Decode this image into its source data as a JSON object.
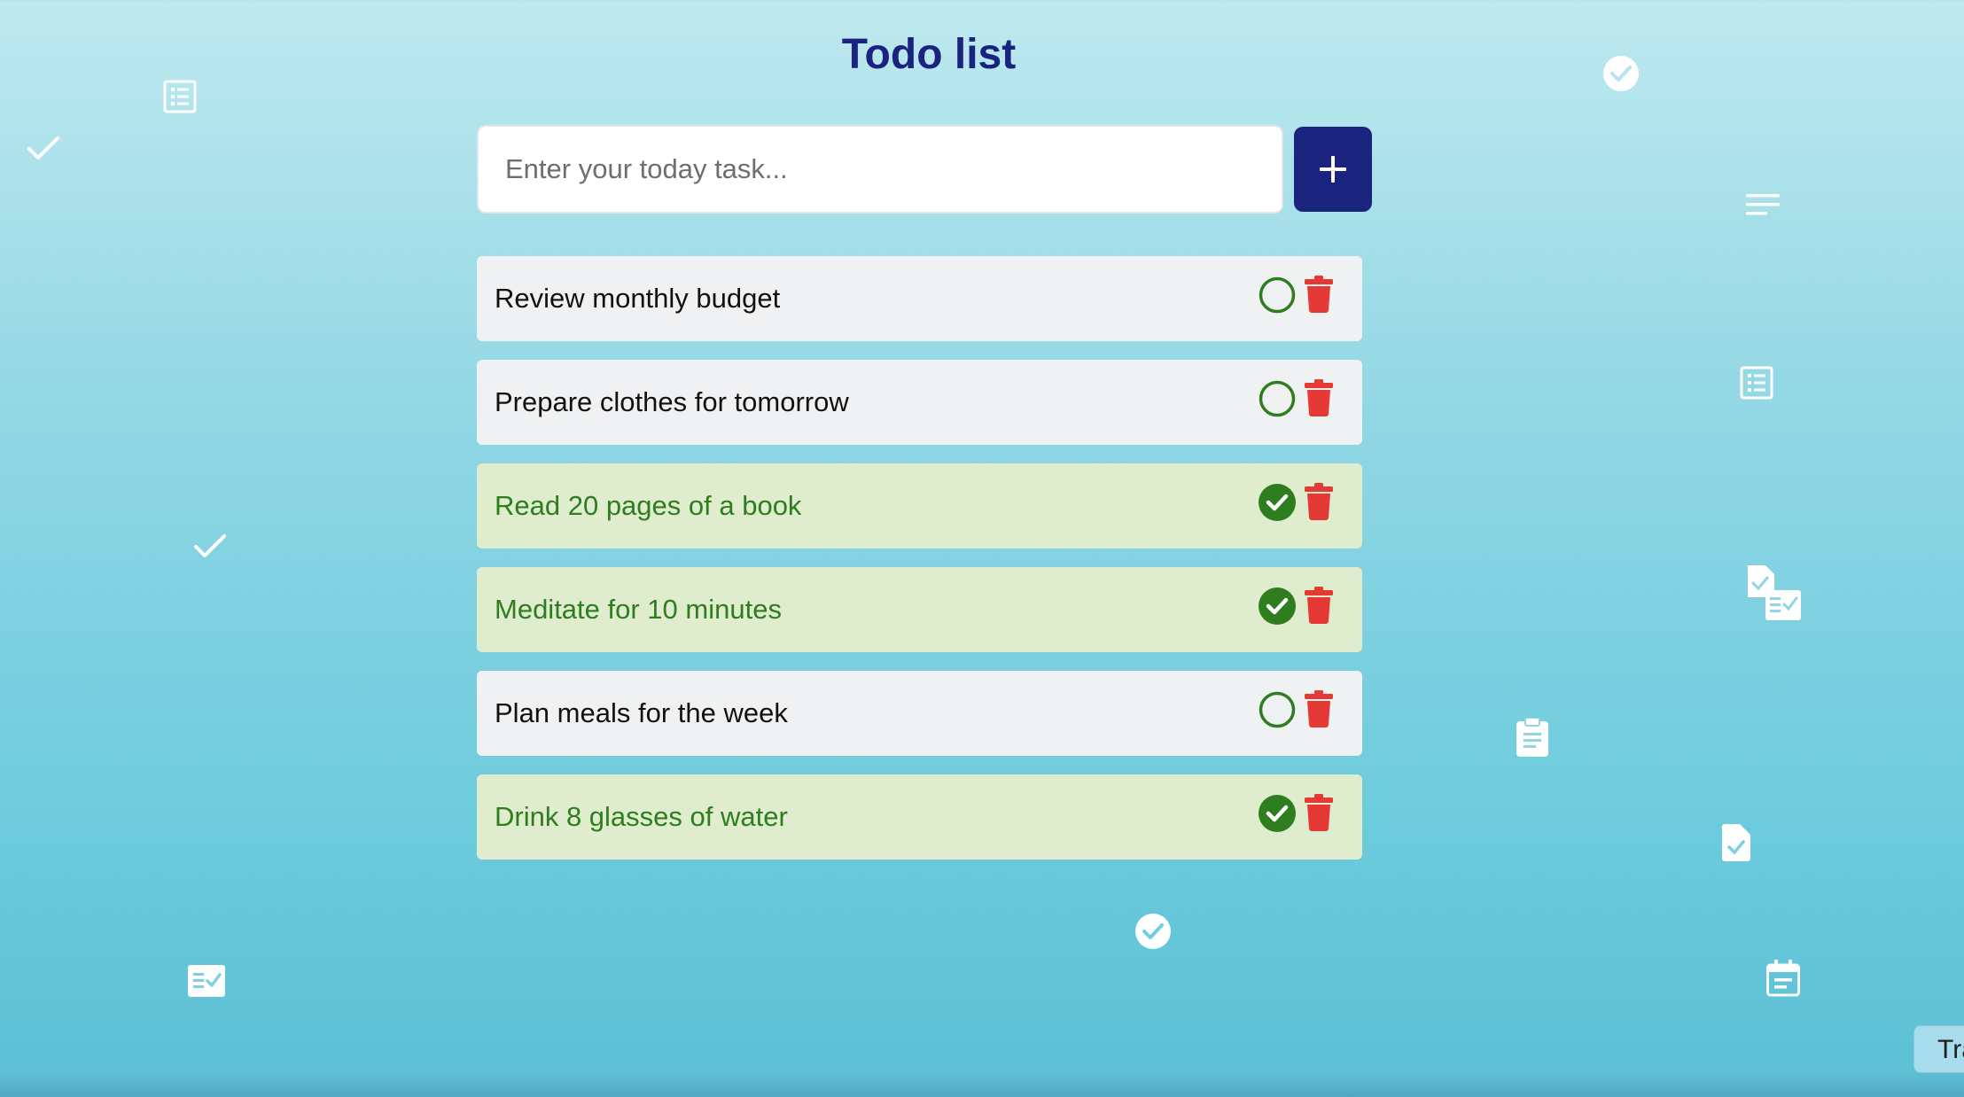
{
  "app": {
    "title": "Todo list"
  },
  "input": {
    "placeholder": "Enter your today task...",
    "value": "",
    "add_button_icon": "plus-icon"
  },
  "tasks": [
    {
      "text": "Review monthly budget",
      "done": false
    },
    {
      "text": "Prepare clothes for tomorrow",
      "done": false
    },
    {
      "text": "Read 20 pages of a book",
      "done": true
    },
    {
      "text": "Meditate for 10 minutes",
      "done": true
    },
    {
      "text": "Plan meals for the week",
      "done": false
    },
    {
      "text": "Drink 8 glasses of water",
      "done": true
    }
  ],
  "translate_tab": {
    "label": "Tra"
  },
  "colors": {
    "title": "#1a237e",
    "add_button": "#1a237e",
    "done_green": "#2e7d1f",
    "delete_red": "#e53935",
    "pending_row": "#f0f1f2",
    "done_row": "#dfecce"
  },
  "decorations": [
    "checkmark-icon",
    "list-icon",
    "check-circle-icon",
    "lines-icon",
    "tasks-icon",
    "clipboard-icon",
    "file-check-icon",
    "calendar-icon",
    "checklist-icon"
  ]
}
